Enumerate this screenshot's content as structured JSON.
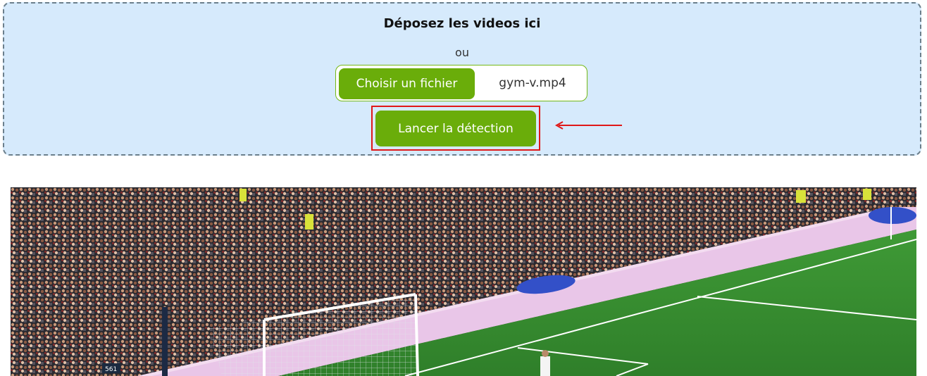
{
  "dropzone": {
    "title": "Déposez les videos ici",
    "or_text": "ou"
  },
  "file_input": {
    "button_label": "Choisir un fichier",
    "file_name": "gym-v.mp4"
  },
  "actions": {
    "launch_label": "Lancer la détection"
  },
  "annotation": {
    "highlight_color": "#e01818",
    "arrow_icon": "arrow-left-icon"
  },
  "video": {
    "description_icon": "video-frame"
  },
  "colors": {
    "accent": "#6aad0a",
    "dropzone_bg": "#d6eafc"
  }
}
